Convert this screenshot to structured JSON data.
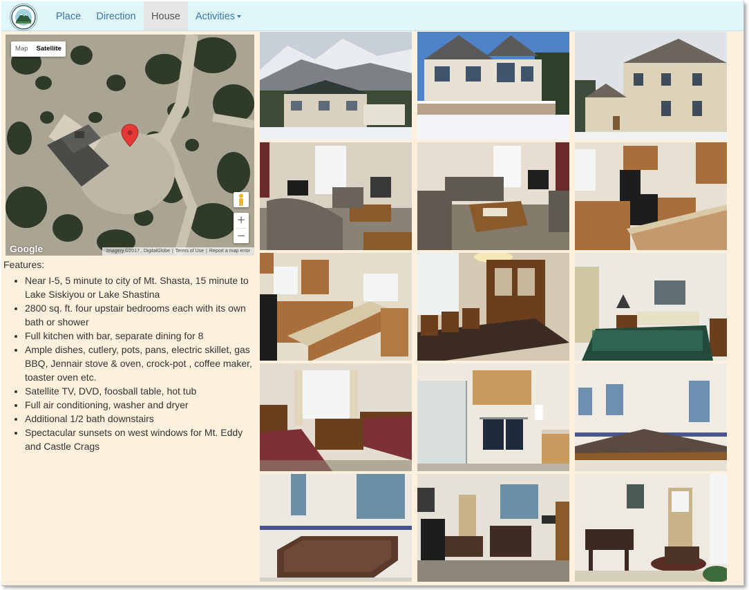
{
  "nav": {
    "items": [
      {
        "label": "Place",
        "active": false
      },
      {
        "label": "Direction",
        "active": false
      },
      {
        "label": "House",
        "active": true
      },
      {
        "label": "Activities",
        "active": false,
        "dropdown": true
      }
    ],
    "logo_icon": "mountain-logo-icon"
  },
  "map": {
    "type_buttons": {
      "map": "Map",
      "satellite": "Satellite"
    },
    "selected_type": "Satellite",
    "zoom_in": "+",
    "zoom_out": "−",
    "logo": "Google",
    "imagery": "Imagery ©2017 , DigitalGlobe",
    "terms": "Terms of Use",
    "report": "Report a map error",
    "marker_icon": "red-map-marker-icon",
    "pegman_icon": "street-view-pegman-icon"
  },
  "features": {
    "title": "Features:",
    "items": [
      "Near I-5, 5 minute to city of Mt. Shasta, 15 minute to Lake Siskiyou or Lake Shastina",
      "2800 sq. ft. four upstair bedrooms each with its own bath or shower",
      "Full kitchen with bar, separate dining for 8",
      "Ample dishes, cutlery, pots, pans, electric skillet, gas BBQ, Jennair stove & oven, crock-pot , coffee maker, toaster oven etc.",
      "Satellite TV, DVD, foosball table, hot tub",
      "Full air conditioning, washer and dryer",
      "Additional 1/2 bath downstairs",
      "Spectacular sunsets on west windows for Mt. Eddy and Castle Crags"
    ]
  },
  "colors": {
    "page_background": "#fdf0dc",
    "navbar_background": "#dff7fb",
    "nav_link": "#3b75b0",
    "active_tab": "#e6e6e6"
  }
}
